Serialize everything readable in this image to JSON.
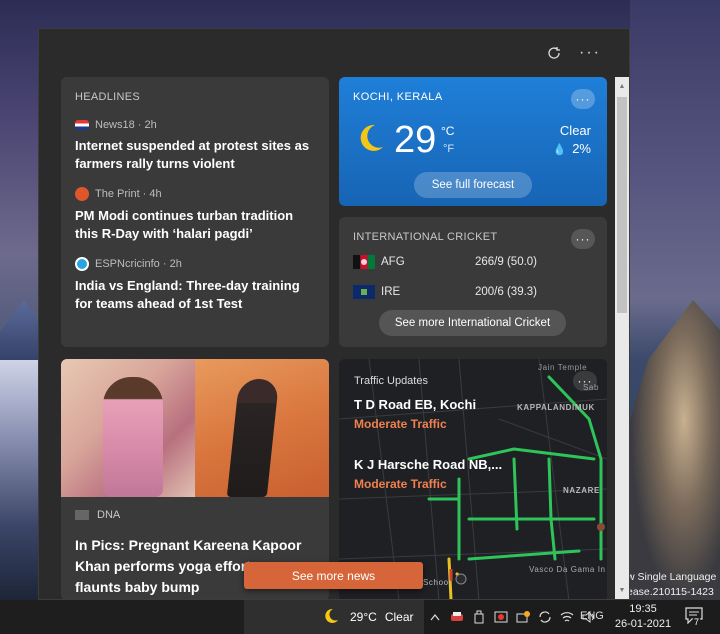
{
  "desktop": {
    "watermark_line1": "w Single Language",
    "watermark_line2": "ease.210115-1423"
  },
  "panel": {
    "refresh_icon": "refresh-icon",
    "more_icon": "more-icon"
  },
  "headlines": {
    "caption": "HEADLINES",
    "items": [
      {
        "source": "News18 · 2h",
        "title": "Internet suspended at protest sites as farmers rally turns violent",
        "logo_color": "#c62828"
      },
      {
        "source": "The Print · 4h",
        "title": "PM Modi continues turban tradition this R-Day with ‘halari pagdi’",
        "logo_color": "#e0552b"
      },
      {
        "source": "ESPNcricinfo · 2h",
        "title": "India vs England: Three-day training for teams ahead of 1st Test",
        "logo_color": "#2aa3e0"
      }
    ]
  },
  "weather": {
    "location": "KOCHI, KERALA",
    "temperature": "29",
    "unit_c": "°C",
    "unit_f": "°F",
    "condition": "Clear",
    "precipitation": "2%",
    "forecast_button": "See full forecast"
  },
  "cricket": {
    "caption": "INTERNATIONAL CRICKET",
    "teams": [
      {
        "name": "AFG",
        "score": "266/9 (50.0)"
      },
      {
        "name": "IRE",
        "score": "200/6 (39.3)"
      }
    ],
    "more_button": "See more International Cricket"
  },
  "story": {
    "source": "DNA",
    "title": "In Pics: Pregnant Kareena Kapoor Khan performs yoga efforts, flaunts baby bump"
  },
  "traffic": {
    "caption": "Traffic Updates",
    "routes": [
      {
        "road": "T D Road EB, Kochi",
        "status": "Moderate Traffic"
      },
      {
        "road": "K J Harsche Road NB,...",
        "status": "Moderate Traffic"
      }
    ],
    "map_labels": [
      "Jain Temple",
      "Sab",
      "KAPPALANDIMUK",
      "NAZARE",
      "School",
      "Vasco Da Gama In"
    ]
  },
  "see_more_news": "See more news",
  "taskbar": {
    "weather_temp": "29°C",
    "weather_cond": "Clear",
    "language": "ENG",
    "time": "19:35",
    "date": "26-01-2021",
    "notification_count": "7"
  },
  "colors": {
    "weather_bg": "#1f7fd8",
    "card_bg": "#3a3a3a",
    "traffic_status": "#f08050",
    "see_more_bg": "#d6663a"
  }
}
